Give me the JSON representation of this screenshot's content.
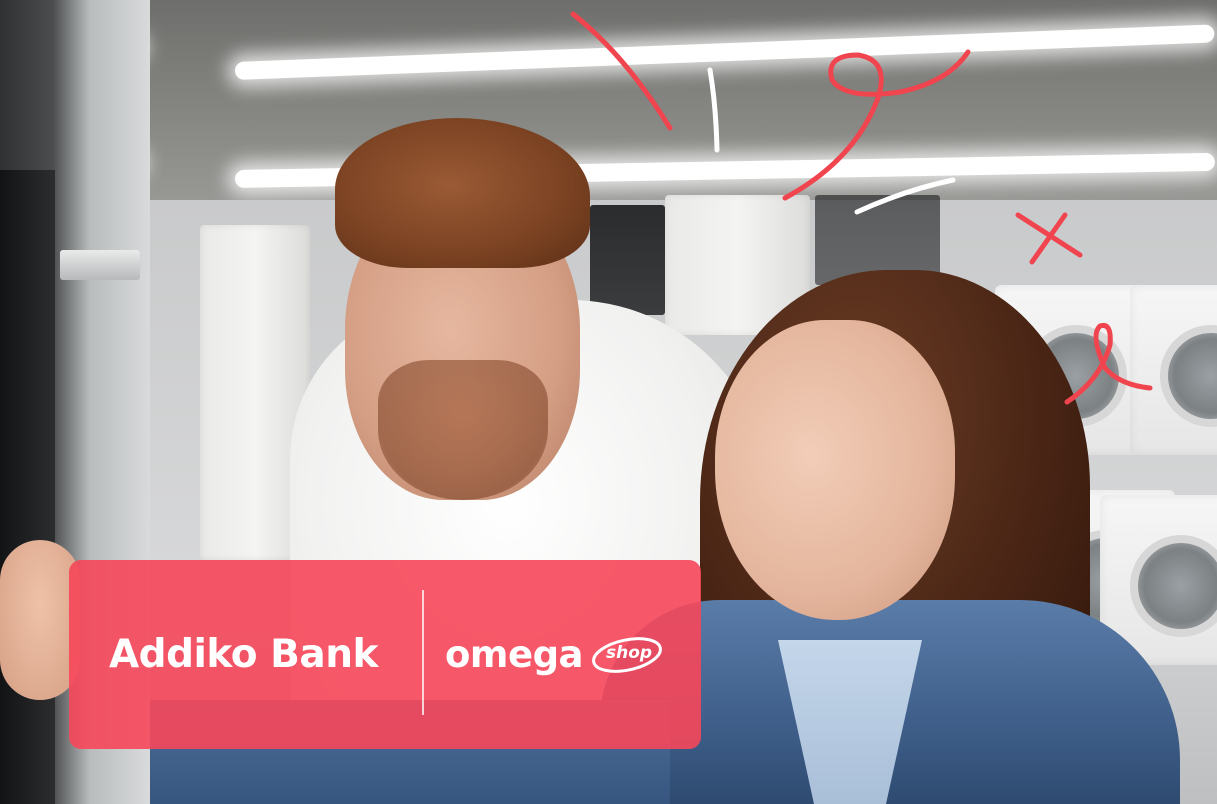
{
  "banner": {
    "brand_left": "Addiko Bank",
    "brand_right_word": "omega",
    "brand_right_badge": "shop"
  },
  "colors": {
    "banner_bg": "#F6475A",
    "doodle_red": "#F0444E",
    "doodle_white": "#FFFFFF"
  }
}
